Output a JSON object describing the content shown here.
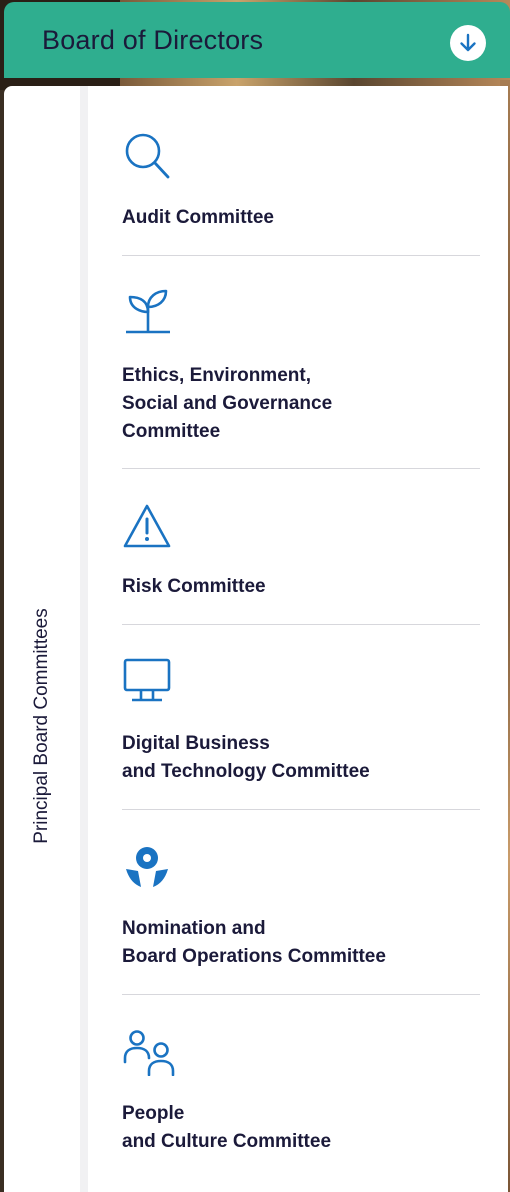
{
  "header": {
    "title": "Board of Directors",
    "toggle_icon": "arrow-down-circle-icon"
  },
  "sidebar": {
    "label": "Principal Board Committees"
  },
  "colors": {
    "header_bg": "#2fae8f",
    "text": "#1b1a3a",
    "icon": "#1a73c2",
    "divider": "#d7d7dc"
  },
  "committees": [
    {
      "icon": "magnifier-icon",
      "label": "Audit Committee"
    },
    {
      "icon": "sprout-icon",
      "label": "Ethics, Environment,\nSocial and Governance\nCommittee"
    },
    {
      "icon": "warning-triangle-icon",
      "label": "Risk Committee"
    },
    {
      "icon": "monitor-icon",
      "label": "Digital Business\nand Technology Committee"
    },
    {
      "icon": "nomination-logo-icon",
      "label": "Nomination and\nBoard Operations Committee"
    },
    {
      "icon": "people-icon",
      "label": "People\nand Culture Committee"
    }
  ]
}
